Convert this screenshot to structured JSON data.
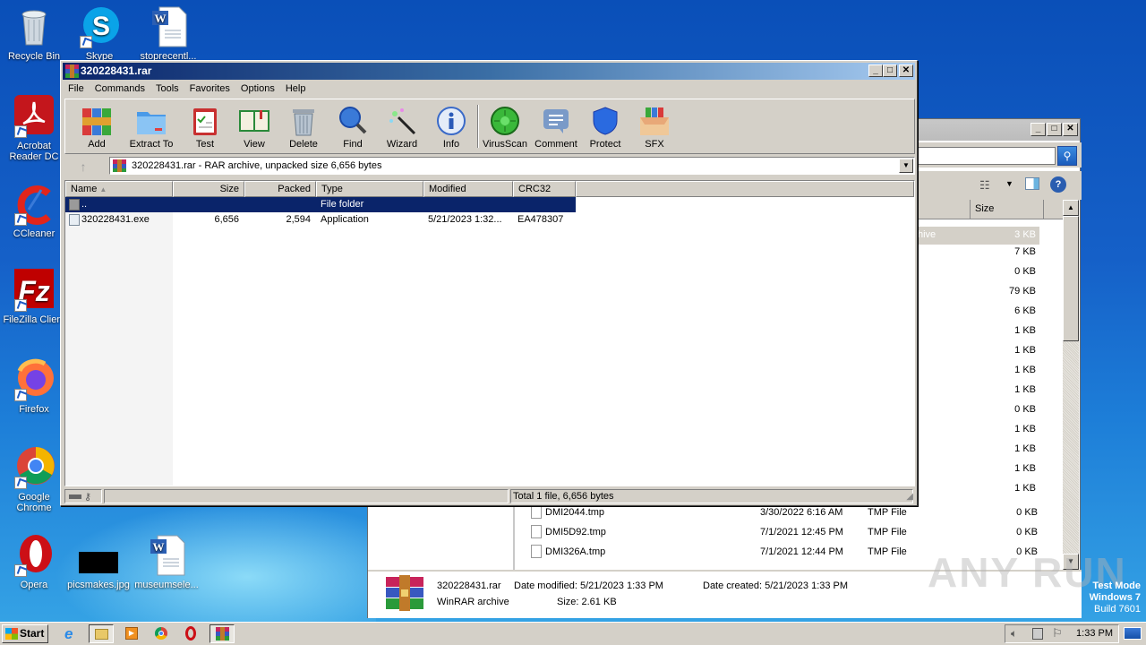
{
  "desktop": {
    "icons": [
      {
        "name": "recycle-bin",
        "label": "Recycle Bin"
      },
      {
        "name": "skype",
        "label": "Skype"
      },
      {
        "name": "stoprecent",
        "label": "stoprecentl..."
      },
      {
        "name": "acrobat",
        "label": "Acrobat Reader DC"
      },
      {
        "name": "ccleaner",
        "label": "CCleaner"
      },
      {
        "name": "filezilla",
        "label": "FileZilla Client"
      },
      {
        "name": "firefox",
        "label": "Firefox"
      },
      {
        "name": "chrome",
        "label": "Google Chrome"
      },
      {
        "name": "opera",
        "label": "Opera"
      },
      {
        "name": "picsmakes",
        "label": "picsmakes.jpg"
      },
      {
        "name": "museumsele",
        "label": "museumsele..."
      }
    ],
    "test_mode": {
      "line1": "Test Mode",
      "line2": "Windows 7",
      "line3": "Build 7601"
    },
    "watermark": "ANY RUN"
  },
  "winrar": {
    "title": "320228431.rar",
    "menu": [
      "File",
      "Commands",
      "Tools",
      "Favorites",
      "Options",
      "Help"
    ],
    "toolbar": [
      {
        "id": "add",
        "label": "Add"
      },
      {
        "id": "extract",
        "label": "Extract To"
      },
      {
        "id": "test",
        "label": "Test"
      },
      {
        "id": "view",
        "label": "View"
      },
      {
        "id": "delete",
        "label": "Delete"
      },
      {
        "id": "find",
        "label": "Find"
      },
      {
        "id": "wizard",
        "label": "Wizard"
      },
      {
        "id": "info",
        "label": "Info"
      },
      {
        "id": "virusscan",
        "label": "VirusScan"
      },
      {
        "id": "comment",
        "label": "Comment"
      },
      {
        "id": "protect",
        "label": "Protect"
      },
      {
        "id": "sfx",
        "label": "SFX"
      }
    ],
    "address": "320228431.rar - RAR archive, unpacked size 6,656 bytes",
    "columns": [
      "Name",
      "Size",
      "Packed",
      "Type",
      "Modified",
      "CRC32"
    ],
    "rows": [
      {
        "name": "..",
        "size": "",
        "packed": "",
        "type": "File folder",
        "modified": "",
        "crc": ""
      },
      {
        "name": "320228431.exe",
        "size": "6,656",
        "packed": "2,594",
        "type": "Application",
        "modified": "5/21/2023 1:32...",
        "crc": "EA478307"
      }
    ],
    "status": "Total 1 file, 6,656 bytes"
  },
  "explorer": {
    "size_header": "Size",
    "partial_type": "hive",
    "sizes": [
      "3 KB",
      "7 KB",
      "0 KB",
      "79 KB",
      "6 KB",
      "1 KB",
      "1 KB",
      "1 KB",
      "1 KB",
      "0 KB",
      "1 KB",
      "1 KB",
      "1 KB",
      "1 KB"
    ],
    "files": [
      {
        "name": "DMI2044.tmp",
        "date": "3/30/2022 6:16 AM",
        "type": "TMP File",
        "size": "0 KB"
      },
      {
        "name": "DMI5D92.tmp",
        "date": "7/1/2021 12:45 PM",
        "type": "TMP File",
        "size": "0 KB"
      },
      {
        "name": "DMI326A.tmp",
        "date": "7/1/2021 12:44 PM",
        "type": "TMP File",
        "size": "0 KB"
      }
    ],
    "details": {
      "filename": "320228431.rar",
      "modified": "Date modified: 5/21/2023 1:33 PM",
      "created": "Date created: 5/21/2023 1:33 PM",
      "type": "WinRAR archive",
      "size": "Size: 2.61 KB"
    }
  },
  "taskbar": {
    "start": "Start",
    "clock": "1:33 PM"
  }
}
